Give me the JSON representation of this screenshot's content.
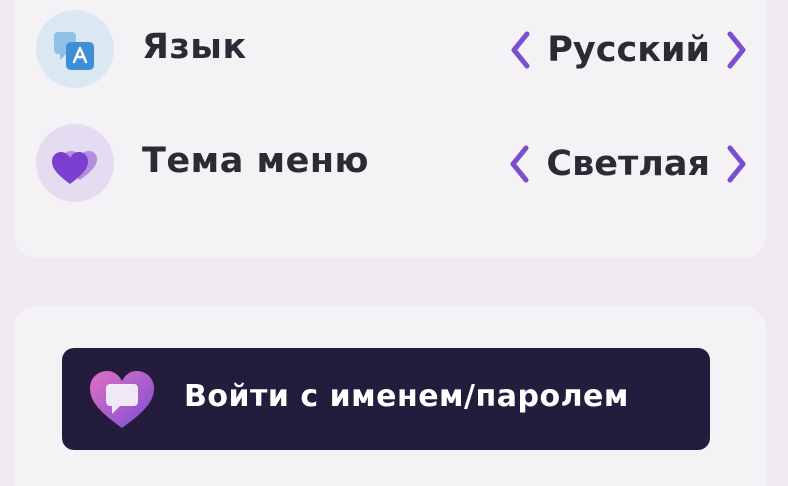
{
  "settings": {
    "language": {
      "label": "Язык",
      "value": "Русский",
      "icon": "translate-icon"
    },
    "theme": {
      "label": "Тема меню",
      "value": "Светлая",
      "icon": "heart-icon"
    }
  },
  "login": {
    "label": "Войти с именем/паролем",
    "icon": "heart-chat-icon"
  },
  "colors": {
    "accent": "#7a4fd0",
    "button_bg": "#231c3c",
    "text": "#2b2b35",
    "background": "#efeaf1"
  }
}
